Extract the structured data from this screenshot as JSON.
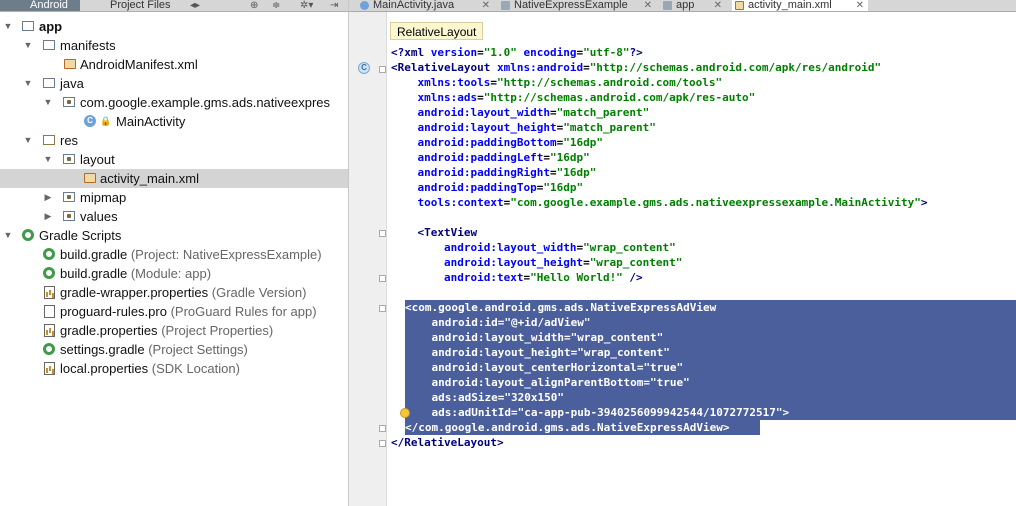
{
  "project_panel": {
    "tab_android": "Android",
    "tab_project_files": "Project Files",
    "tree": [
      {
        "label": "app",
        "hint": ""
      },
      {
        "label": "manifests",
        "hint": ""
      },
      {
        "label": "AndroidManifest.xml",
        "hint": ""
      },
      {
        "label": "java",
        "hint": ""
      },
      {
        "label": "com.google.example.gms.ads.nativeexpres",
        "hint": ""
      },
      {
        "label": "MainActivity",
        "hint": ""
      },
      {
        "label": "res",
        "hint": ""
      },
      {
        "label": "layout",
        "hint": ""
      },
      {
        "label": "activity_main.xml",
        "hint": ""
      },
      {
        "label": "mipmap",
        "hint": ""
      },
      {
        "label": "values",
        "hint": ""
      },
      {
        "label": "Gradle Scripts",
        "hint": ""
      },
      {
        "label": "build.gradle",
        "hint": "(Project: NativeExpressExample)"
      },
      {
        "label": "build.gradle",
        "hint": "(Module: app)"
      },
      {
        "label": "gradle-wrapper.properties",
        "hint": "(Gradle Version)"
      },
      {
        "label": "proguard-rules.pro",
        "hint": "(ProGuard Rules for app)"
      },
      {
        "label": "gradle.properties",
        "hint": "(Project Properties)"
      },
      {
        "label": "settings.gradle",
        "hint": "(Project Settings)"
      },
      {
        "label": "local.properties",
        "hint": "(SDK Location)"
      }
    ]
  },
  "editor": {
    "tabs": [
      "MainActivity.java",
      "NativeExpressExample",
      "app",
      "activity_main.xml"
    ],
    "breadcrumb": "RelativeLayout",
    "lines": [
      "<?xml version=\"1.0\" encoding=\"utf-8\"?>",
      "<RelativeLayout xmlns:android=\"http://schemas.android.com/apk/res/android\"",
      "    xmlns:tools=\"http://schemas.android.com/tools\"",
      "    xmlns:ads=\"http://schemas.android.com/apk/res-auto\"",
      "    android:layout_width=\"match_parent\"",
      "    android:layout_height=\"match_parent\"",
      "    android:paddingBottom=\"16dp\"",
      "    android:paddingLeft=\"16dp\"",
      "    android:paddingRight=\"16dp\"",
      "    android:paddingTop=\"16dp\"",
      "    tools:context=\"com.google.example.gms.ads.nativeexpressexample.MainActivity\">",
      "",
      "    <TextView",
      "        android:layout_width=\"wrap_content\"",
      "        android:layout_height=\"wrap_content\"",
      "        android:text=\"Hello World!\" />",
      "",
      "    <com.google.android.gms.ads.NativeExpressAdView",
      "        android:id=\"@+id/adView\"",
      "        android:layout_width=\"wrap_content\"",
      "        android:layout_height=\"wrap_content\"",
      "        android:layout_centerHorizontal=\"true\"",
      "        android:layout_alignParentBottom=\"true\"",
      "        ads:adSize=\"320x150\"",
      "        ads:adUnitId=\"ca-app-pub-3940256099942544/1072772517\">",
      "    </com.google.android.gms.ads.NativeExpressAdView>",
      "</RelativeLayout>"
    ]
  },
  "colors": {
    "selection": "#4b5f9c",
    "tag": "#000080",
    "attr": "#0000ff",
    "value": "#008000"
  }
}
